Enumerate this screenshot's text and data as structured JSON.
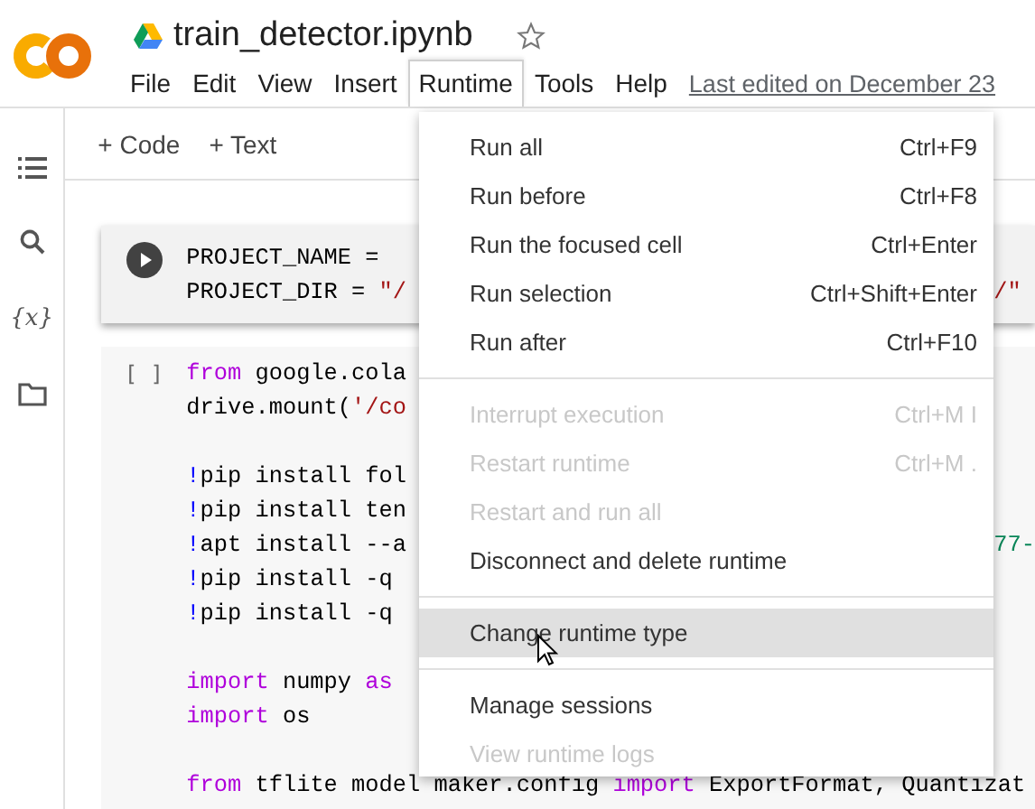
{
  "header": {
    "title": "train_detector.ipynb",
    "starred": false,
    "last_edited": "Last edited on December 23"
  },
  "menubar": [
    {
      "label": "File",
      "selected": false
    },
    {
      "label": "Edit",
      "selected": false
    },
    {
      "label": "View",
      "selected": false
    },
    {
      "label": "Insert",
      "selected": false
    },
    {
      "label": "Runtime",
      "selected": true
    },
    {
      "label": "Tools",
      "selected": false
    },
    {
      "label": "Help",
      "selected": false
    }
  ],
  "sidebar": {
    "variables_label": "{x}"
  },
  "toolbar": [
    "+ Code",
    "+ Text"
  ],
  "cells": [
    {
      "running_button": true,
      "lines": [
        {
          "tokens": [
            {
              "text": "PROJECT_NAME = ",
              "kind": "plain"
            }
          ]
        },
        {
          "tokens": [
            {
              "text": "PROJECT_DIR = ",
              "kind": "plain"
            },
            {
              "text": "\"/",
              "kind": "string"
            }
          ],
          "right": {
            "text": "/\"",
            "kind": "string"
          }
        }
      ]
    },
    {
      "running_button": false,
      "prompt": "[ ]",
      "lines": [
        {
          "tokens": [
            {
              "text": "from",
              "kind": "keyword"
            },
            {
              "text": " google.cola",
              "kind": "plain"
            }
          ]
        },
        {
          "tokens": [
            {
              "text": "drive.mount(",
              "kind": "plain"
            },
            {
              "text": "'/co",
              "kind": "string"
            }
          ]
        },
        {
          "kind": "blank"
        },
        {
          "tokens": [
            {
              "text": "!",
              "kind": "bang"
            },
            {
              "text": "pip install fol",
              "kind": "plain"
            }
          ]
        },
        {
          "tokens": [
            {
              "text": "!",
              "kind": "bang"
            },
            {
              "text": "pip install ten",
              "kind": "plain"
            }
          ]
        },
        {
          "tokens": [
            {
              "text": "!",
              "kind": "bang"
            },
            {
              "text": "apt install --a",
              "kind": "plain"
            }
          ],
          "right": {
            "text": "77-",
            "kind": "number"
          }
        },
        {
          "tokens": [
            {
              "text": "!",
              "kind": "bang"
            },
            {
              "text": "pip install -q",
              "kind": "plain"
            }
          ]
        },
        {
          "tokens": [
            {
              "text": "!",
              "kind": "bang"
            },
            {
              "text": "pip install -q",
              "kind": "plain"
            }
          ]
        },
        {
          "kind": "blank"
        },
        {
          "tokens": [
            {
              "text": "import",
              "kind": "keyword"
            },
            {
              "text": " numpy ",
              "kind": "plain"
            },
            {
              "text": "as",
              "kind": "keyword"
            }
          ]
        },
        {
          "tokens": [
            {
              "text": "import",
              "kind": "keyword"
            },
            {
              "text": " os",
              "kind": "plain"
            }
          ]
        },
        {
          "kind": "blank"
        },
        {
          "tokens": [
            {
              "text": "from",
              "kind": "keyword"
            },
            {
              "text": " tflite model maker.config ",
              "kind": "plain"
            },
            {
              "text": "import",
              "kind": "keyword"
            },
            {
              "text": " ExportFormat, Quantizat",
              "kind": "plain"
            }
          ]
        }
      ]
    }
  ],
  "runtime_menu": [
    {
      "kind": "item",
      "label": "Run all",
      "shortcut": "Ctrl+F9",
      "disabled": false,
      "selected": false
    },
    {
      "kind": "item",
      "label": "Run before",
      "shortcut": "Ctrl+F8",
      "disabled": false,
      "selected": false
    },
    {
      "kind": "item",
      "label": "Run the focused cell",
      "shortcut": "Ctrl+Enter",
      "disabled": false,
      "selected": false
    },
    {
      "kind": "item",
      "label": "Run selection",
      "shortcut": "Ctrl+Shift+Enter",
      "disabled": false,
      "selected": false
    },
    {
      "kind": "item",
      "label": "Run after",
      "shortcut": "Ctrl+F10",
      "disabled": false,
      "selected": false
    },
    {
      "kind": "divider"
    },
    {
      "kind": "item",
      "label": "Interrupt execution",
      "shortcut": "Ctrl+M I",
      "disabled": true,
      "selected": false
    },
    {
      "kind": "item",
      "label": "Restart runtime",
      "shortcut": "Ctrl+M .",
      "disabled": true,
      "selected": false
    },
    {
      "kind": "item",
      "label": "Restart and run all",
      "disabled": true,
      "selected": false
    },
    {
      "kind": "item",
      "label": "Disconnect and delete runtime",
      "disabled": false,
      "selected": false
    },
    {
      "kind": "divider"
    },
    {
      "kind": "item",
      "label": "Change runtime type",
      "disabled": false,
      "selected": true
    },
    {
      "kind": "divider"
    },
    {
      "kind": "item",
      "label": "Manage sessions",
      "disabled": false,
      "selected": false
    },
    {
      "kind": "item",
      "label": "View runtime logs",
      "disabled": true,
      "selected": false
    }
  ]
}
